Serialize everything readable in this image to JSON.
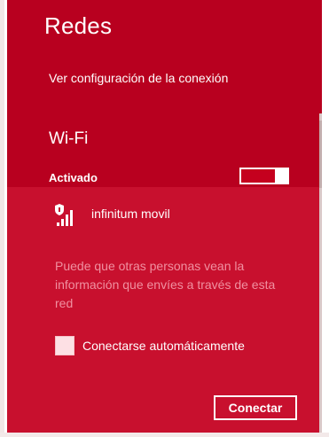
{
  "title": "Redes",
  "view_settings_link": "Ver configuración de la conexión",
  "section": "Wi-Fi",
  "wifi_toggle": {
    "label": "Activado",
    "on": true
  },
  "network": {
    "name": "infinitum movil",
    "icon": "wifi-secured-signal-icon",
    "warning": "Puede que otras personas vean la información que envíes a través de esta red",
    "auto_connect_label": "Conectarse automáticamente",
    "auto_connect_checked": false,
    "connect_button": "Conectar"
  },
  "colors": {
    "pane_background": "#b8001f",
    "selected_item_background": "#c8102e",
    "warning_text": "#f090a0"
  }
}
